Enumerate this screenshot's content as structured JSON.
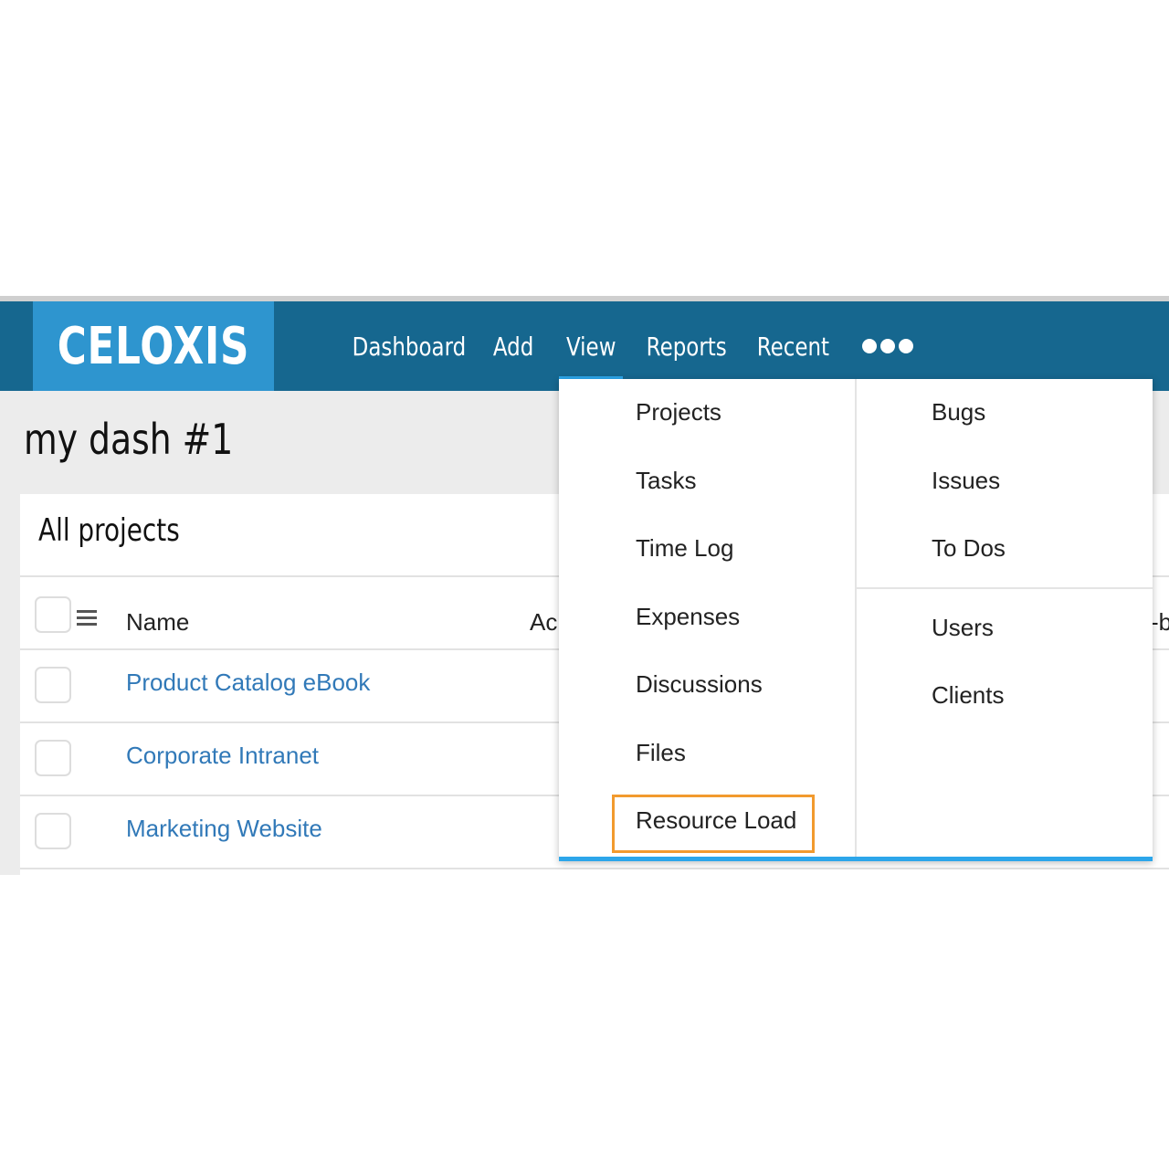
{
  "brand": {
    "logo_text": "CELOXIS",
    "nav_color": "#16678f",
    "logo_bg": "#2e95cf",
    "accent": "#2ca6ea",
    "highlight_color": "#f29a2e"
  },
  "nav": {
    "items": [
      {
        "label": "Dashboard"
      },
      {
        "label": "Add"
      },
      {
        "label": "View",
        "active": true
      },
      {
        "label": "Reports"
      },
      {
        "label": "Recent"
      }
    ],
    "more_icon": "more-dots-icon"
  },
  "page": {
    "title": "my dash #1"
  },
  "panel": {
    "title": "All projects",
    "columns": {
      "name": "Name",
      "actual_partial": "Ac",
      "right_partial": "-b"
    },
    "rows": [
      {
        "name": "Product Catalog eBook"
      },
      {
        "name": "Corporate Intranet"
      },
      {
        "name": "Marketing Website"
      }
    ]
  },
  "view_menu": {
    "left": [
      "Projects",
      "Tasks",
      "Time Log",
      "Expenses",
      "Discussions",
      "Files",
      "Resource Load"
    ],
    "right_top": [
      "Bugs",
      "Issues",
      "To Dos"
    ],
    "right_bottom": [
      "Users",
      "Clients"
    ],
    "highlighted": "Resource Load"
  }
}
